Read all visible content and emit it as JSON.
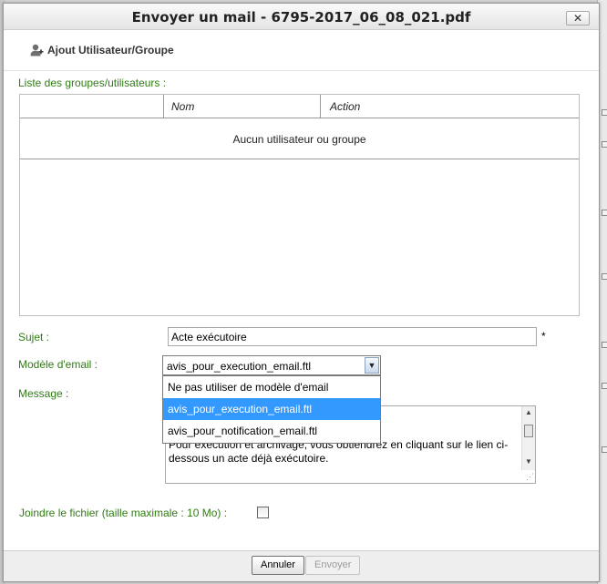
{
  "dialog": {
    "title": "Envoyer un mail - 6795-2017_06_08_021.pdf",
    "close_label": "✕"
  },
  "toolbar": {
    "add_user_label": "Ajout Utilisateur/Groupe"
  },
  "list": {
    "label": "Liste des groupes/utilisateurs :",
    "columns": [
      "",
      "Nom",
      "Action"
    ],
    "empty_text": "Aucun utilisateur ou groupe"
  },
  "form": {
    "subject_label": "Sujet :",
    "subject_value": "Acte exécutoire",
    "required_mark": "*",
    "template_label": "Modèle d'email :",
    "template_selected": "avis_pour_execution_email.ftl",
    "template_options": [
      "Ne pas utiliser de modèle d'email",
      "avis_pour_execution_email.ftl",
      "avis_pour_notification_email.ftl"
    ],
    "message_label": "Message :",
    "message_text": "Pour exécution et archivage, vous obtiendrez en cliquant sur le lien ci-dessous un acte déjà exécutoire.",
    "attach_label": "Joindre le fichier (taille maximale : 10 Mo) :",
    "attach_checked": false
  },
  "footer": {
    "cancel_label": "Annuler",
    "send_label": "Envoyer"
  },
  "colors": {
    "label_green": "#2e7d12",
    "selected_option": "#3399ff"
  },
  "icons": {
    "add_user": "user-add-icon",
    "dropdown": "chevron-down-icon"
  }
}
